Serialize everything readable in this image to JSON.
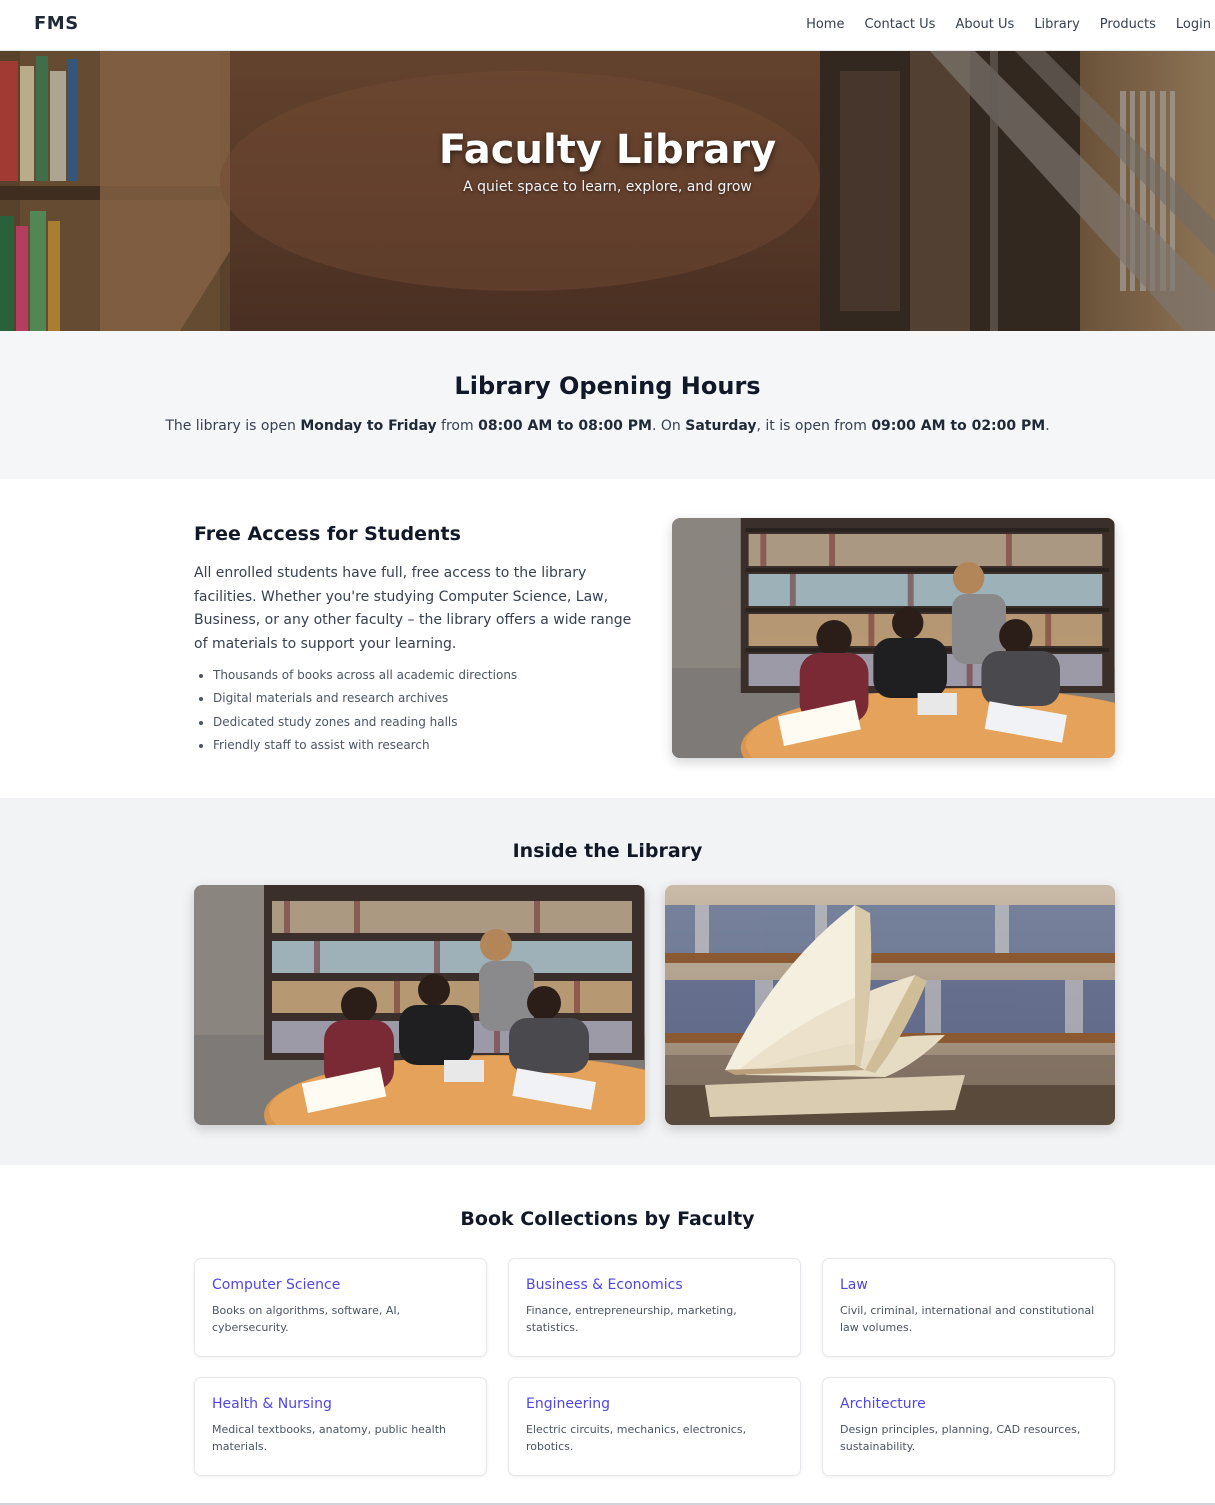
{
  "navbar": {
    "brand": "FMS",
    "links": [
      "Home",
      "Contact Us",
      "About Us",
      "Library",
      "Products",
      "Login"
    ]
  },
  "hero": {
    "title": "Faculty Library",
    "subtitle": "A quiet space to learn, explore, and grow"
  },
  "hours": {
    "title": "Library Opening Hours",
    "text_1": "The library is open ",
    "bold_1": "Monday to Friday",
    "text_2": " from ",
    "bold_2": "08:00 AM to 08:00 PM",
    "text_3": ". On ",
    "bold_3": "Saturday",
    "text_4": ", it is open from ",
    "bold_4": "09:00 AM to 02:00 PM",
    "text_5": "."
  },
  "access": {
    "title": "Free Access for Students",
    "description": "All enrolled students have full, free access to the library facilities. Whether you're studying Computer Science, Law, Business, or any other faculty – the library offers a wide range of materials to support your learning.",
    "items": [
      "Thousands of books across all academic directions",
      "Digital materials and research archives",
      "Dedicated study zones and reading halls",
      "Friendly staff to assist with research"
    ]
  },
  "inside": {
    "title": "Inside the Library"
  },
  "collections": {
    "title": "Book Collections by Faculty",
    "cards": [
      {
        "title": "Computer Science",
        "desc": "Books on algorithms, software, AI, cybersecurity."
      },
      {
        "title": "Business & Economics",
        "desc": "Finance, entrepreneurship, marketing, statistics."
      },
      {
        "title": "Law",
        "desc": "Civil, criminal, international and constitutional law volumes."
      },
      {
        "title": "Health & Nursing",
        "desc": "Medical textbooks, anatomy, public health materials."
      },
      {
        "title": "Engineering",
        "desc": "Electric circuits, mechanics, electronics, robotics."
      },
      {
        "title": "Architecture",
        "desc": "Design principles, planning, CAD resources, sustainability."
      }
    ]
  },
  "colors": {
    "accent": "#4f46e5",
    "hero_floor": "#6b4634",
    "section_bg": "#f5f6f8"
  }
}
